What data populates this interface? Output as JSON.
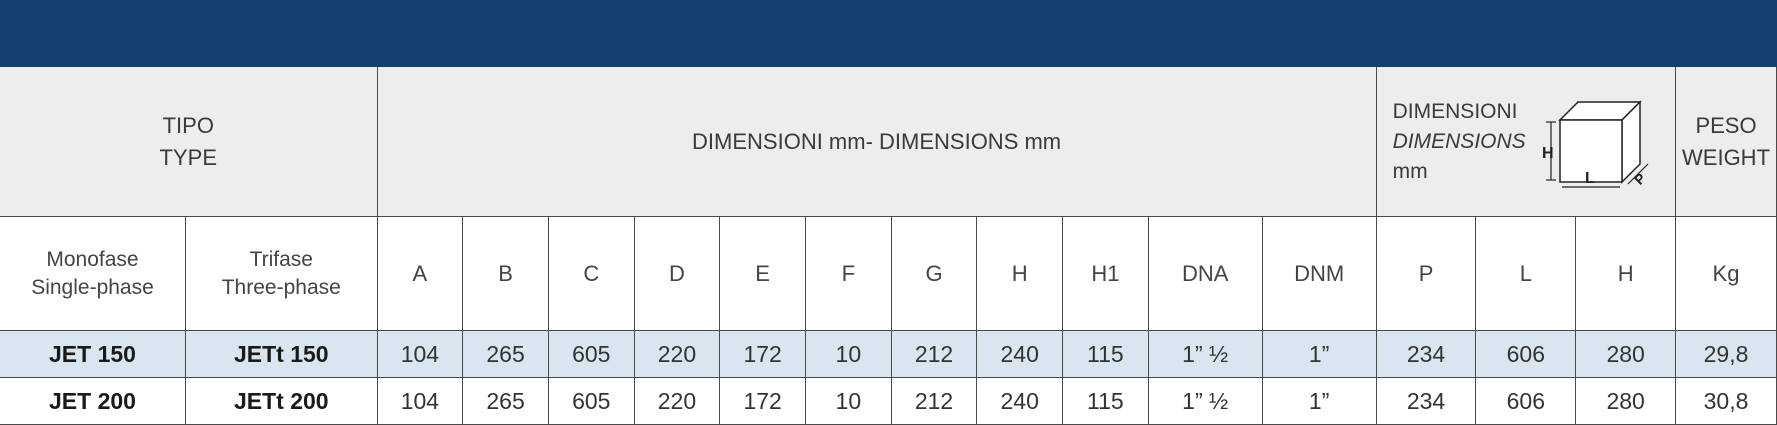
{
  "header": {
    "tipo": "TIPO",
    "type": "TYPE",
    "dimensions_title": "DIMENSIONI mm- DIMENSIONS mm",
    "pack_dim_it": "DIMENSIONI",
    "pack_dim_en": "DIMENSIONS",
    "pack_dim_unit": "mm",
    "peso": "PESO",
    "weight": "WEIGHT",
    "diagram_labels": {
      "h": "H",
      "l": "L",
      "p": "P"
    }
  },
  "columns": {
    "mono_it": "Monofase",
    "mono_en": "Single-phase",
    "tri_it": "Trifase",
    "tri_en": "Three-phase",
    "dims": [
      "A",
      "B",
      "C",
      "D",
      "E",
      "F",
      "G",
      "H",
      "H1",
      "DNA",
      "DNM",
      "P",
      "L",
      "H",
      "Kg"
    ]
  },
  "rows": [
    {
      "mono": "JET 150",
      "tri": "JETt 150",
      "values": [
        "104",
        "265",
        "605",
        "220",
        "172",
        "10",
        "212",
        "240",
        "115",
        "1” ½",
        "1”",
        "234",
        "606",
        "280",
        "29,8"
      ]
    },
    {
      "mono": "JET 200",
      "tri": "JETt 200",
      "values": [
        "104",
        "265",
        "605",
        "220",
        "172",
        "10",
        "212",
        "240",
        "115",
        "1” ½",
        "1”",
        "234",
        "606",
        "280",
        "30,8"
      ]
    }
  ],
  "colors": {
    "topbar": "#153f6f",
    "header_bg": "#ededed",
    "row_highlight": "#d9e6ef"
  }
}
